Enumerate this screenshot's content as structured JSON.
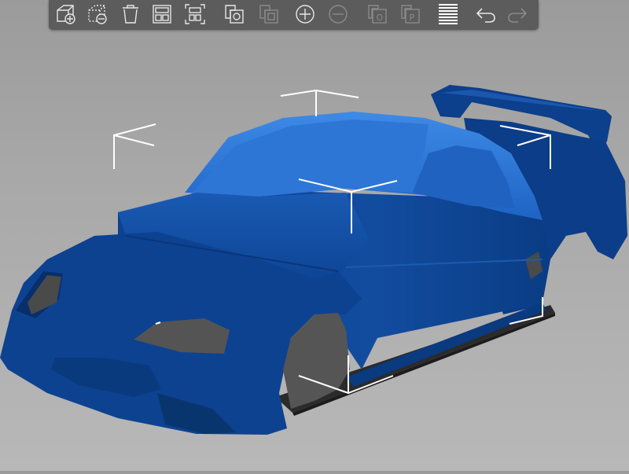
{
  "app": {
    "toolbar": {
      "items": [
        {
          "name": "add",
          "icon": "add-object-icon",
          "enabled": true
        },
        {
          "name": "delete",
          "icon": "delete-object-icon",
          "enabled": true
        },
        {
          "name": "delete-all",
          "icon": "trash-icon",
          "enabled": true
        },
        {
          "name": "arrange",
          "icon": "arrange-icon",
          "enabled": true
        },
        {
          "name": "arrange-selection",
          "icon": "arrange-selection-icon",
          "enabled": true
        },
        {
          "name": "copy",
          "icon": "copy-icon",
          "enabled": true
        },
        {
          "name": "paste",
          "icon": "paste-icon",
          "enabled": false
        },
        {
          "name": "add-instance",
          "icon": "zoom-in-icon",
          "enabled": true
        },
        {
          "name": "remove-instance",
          "icon": "zoom-out-icon",
          "enabled": false
        },
        {
          "name": "split-objects",
          "icon": "split-objects-icon",
          "enabled": false
        },
        {
          "name": "split-parts",
          "icon": "split-parts-icon",
          "enabled": false
        },
        {
          "name": "layers-editing",
          "icon": "layers-icon",
          "enabled": true
        },
        {
          "name": "undo",
          "icon": "undo-icon",
          "enabled": true
        },
        {
          "name": "redo",
          "icon": "redo-icon",
          "enabled": false
        }
      ]
    },
    "colors": {
      "model_dark": "#0a3f8c",
      "model_mid": "#1f5fb5",
      "model_light": "#3a86e0",
      "bed": "#2a2a2a",
      "toolbar_bg": "#5c5c5c",
      "icon_enabled": "#e6e6e6",
      "icon_disabled": "#8a8a8a"
    }
  }
}
